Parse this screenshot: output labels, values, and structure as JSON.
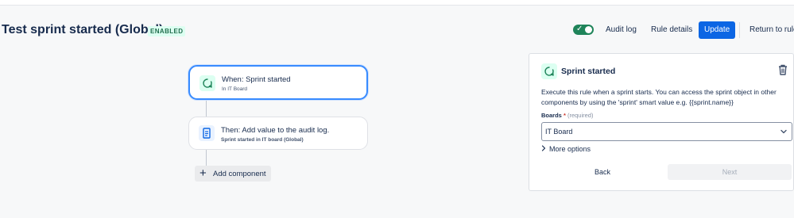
{
  "header": {
    "title": "Test sprint started (Global)",
    "status": "ENABLED",
    "toggle_on": true,
    "audit_log_label": "Audit log",
    "rule_details_label": "Rule details",
    "update_label": "Update",
    "return_label": "Return to rule"
  },
  "canvas": {
    "trigger": {
      "title": "When: Sprint started",
      "subtitle": "In IT Board",
      "icon": "trigger-icon"
    },
    "action": {
      "title": "Then: Add value to the audit log.",
      "subtitle": "Sprint started in IT board (Global)",
      "icon": "document-icon"
    },
    "add_component_label": "Add component"
  },
  "panel": {
    "title": "Sprint started",
    "description": "Execute this rule when a sprint starts. You can access the sprint object in other components by using the 'sprint' smart value e.g. {{sprint.name}}",
    "boards_label": "Boards",
    "required_marker": "*",
    "required_hint": "(required)",
    "boards_value": "IT Board",
    "more_options_label": "More options",
    "back_label": "Back",
    "next_label": "Next"
  },
  "colors": {
    "primary": "#0c66e4",
    "success": "#1f845a",
    "focus": "#388bff"
  }
}
